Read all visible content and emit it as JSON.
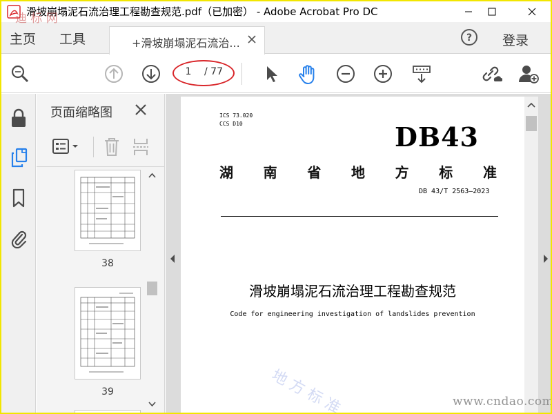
{
  "window": {
    "title": "滑坡崩塌泥石流治理工程勘查规范.pdf（已加密） - Adobe Acrobat Pro DC"
  },
  "menubar": {
    "home_label": "主页",
    "tools_label": "工具",
    "document_tab_label": "+滑坡崩塌泥石流治...",
    "login_label": "登录"
  },
  "toolbar": {
    "current_page": "1",
    "total_pages": "/ 77"
  },
  "thumbnail_panel": {
    "title": "页面缩略图",
    "thumbnails": [
      {
        "label": "38"
      },
      {
        "label": "39"
      }
    ]
  },
  "document": {
    "ics": "ICS  73.020",
    "ccs": "CCS D10",
    "standard_mark": "DB43",
    "province_chars": [
      "湖",
      "南",
      "省",
      "地",
      "方",
      "标",
      "准"
    ],
    "standard_number": "DB 43/T 2563—2023",
    "title": "滑坡崩塌泥石流治理工程勘查规范",
    "subtitle": "Code for engineering investigation of landslides prevention"
  },
  "watermarks": {
    "logo_text": "迪 标 网",
    "diagonal_text": "地 方 标 准",
    "url_text": "www.cndao.com"
  },
  "colors": {
    "frame_yellow": "#f2e600",
    "oval_red": "#d9262a",
    "toolbar_icon": "#4b4b4b",
    "accent_blue": "#2680eb"
  }
}
